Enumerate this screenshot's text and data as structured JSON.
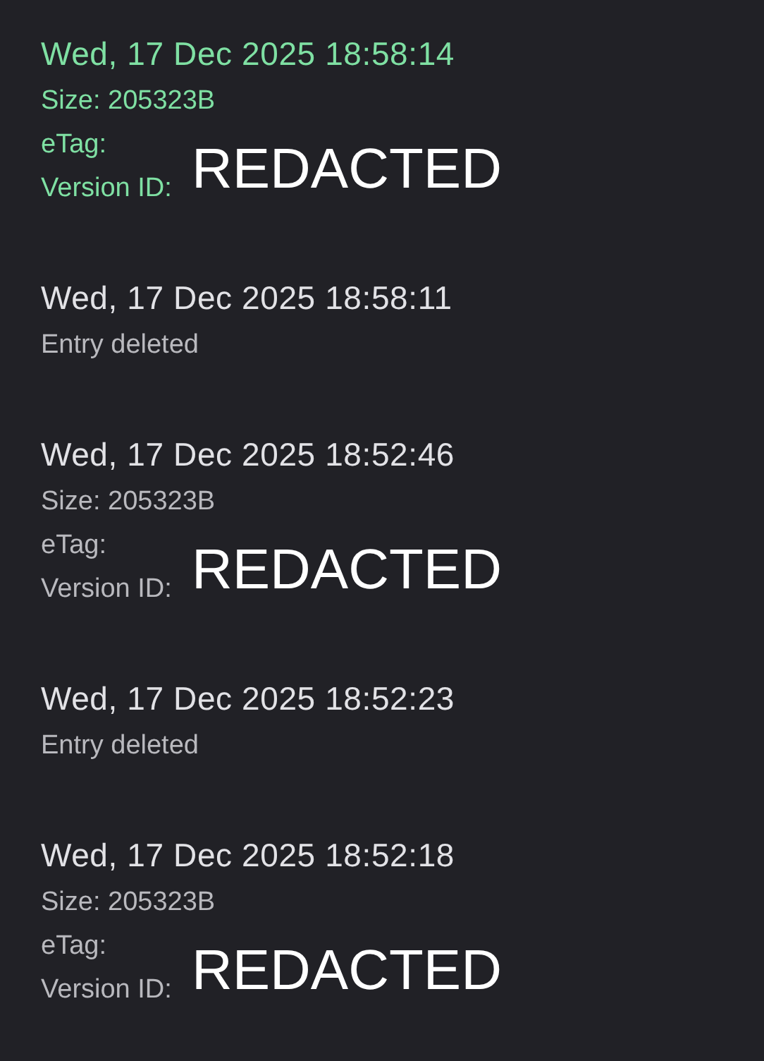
{
  "entries": [
    {
      "kind": "version",
      "selected": true,
      "timestamp": "Wed, 17 Dec 2025 18:58:14",
      "size": "Size: 205323B",
      "etag_label": "eTag:",
      "version_label": "Version ID:",
      "redaction": "REDACTED"
    },
    {
      "kind": "deleted",
      "selected": false,
      "timestamp": "Wed, 17 Dec 2025 18:58:11",
      "note": "Entry deleted"
    },
    {
      "kind": "version",
      "selected": false,
      "timestamp": "Wed, 17 Dec 2025 18:52:46",
      "size": "Size: 205323B",
      "etag_label": "eTag:",
      "version_label": "Version ID:",
      "redaction": "REDACTED"
    },
    {
      "kind": "deleted",
      "selected": false,
      "timestamp": "Wed, 17 Dec 2025 18:52:23",
      "note": "Entry deleted"
    },
    {
      "kind": "version",
      "selected": false,
      "timestamp": "Wed, 17 Dec 2025 18:52:18",
      "size": "Size: 205323B",
      "etag_label": "eTag:",
      "version_label": "Version ID:",
      "redaction": "REDACTED"
    }
  ]
}
